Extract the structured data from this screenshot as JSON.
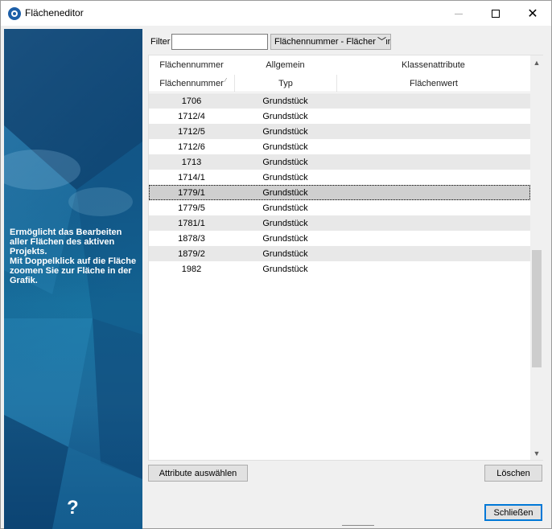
{
  "window": {
    "title": "Flächeneditor"
  },
  "sidebar": {
    "description": "Ermöglicht das Bearbeiten aller Flächen des aktiven Projekts.\nMit Doppelklick auf die Fläche zoomen Sie zur Fläche in der Grafik.",
    "help": "?"
  },
  "filter": {
    "label": "Filter",
    "value": "",
    "select_value": "Flächennummer - Flächennummer"
  },
  "grid": {
    "group_headers": [
      "Flächennummer",
      "Allgemein",
      "Klassenattribute"
    ],
    "columns": [
      "Flächennummer",
      "Typ",
      "Flächenwert"
    ],
    "sort_column": "Flächennummer",
    "sort_direction": "ascending",
    "rows": [
      {
        "nummer": "1706",
        "typ": "Grundstück",
        "wert": ""
      },
      {
        "nummer": "1712/4",
        "typ": "Grundstück",
        "wert": ""
      },
      {
        "nummer": "1712/5",
        "typ": "Grundstück",
        "wert": ""
      },
      {
        "nummer": "1712/6",
        "typ": "Grundstück",
        "wert": ""
      },
      {
        "nummer": "1713",
        "typ": "Grundstück",
        "wert": ""
      },
      {
        "nummer": "1714/1",
        "typ": "Grundstück",
        "wert": ""
      },
      {
        "nummer": "1779/1",
        "typ": "Grundstück",
        "wert": ""
      },
      {
        "nummer": "1779/5",
        "typ": "Grundstück",
        "wert": ""
      },
      {
        "nummer": "1781/1",
        "typ": "Grundstück",
        "wert": ""
      },
      {
        "nummer": "1878/3",
        "typ": "Grundstück",
        "wert": ""
      },
      {
        "nummer": "1879/2",
        "typ": "Grundstück",
        "wert": ""
      },
      {
        "nummer": "1982",
        "typ": "Grundstück",
        "wert": ""
      }
    ],
    "selected_row": "1779/1"
  },
  "buttons": {
    "attributes": "Attribute auswählen",
    "delete": "Löschen",
    "close": "Schließen"
  },
  "colors": {
    "selection": "#cfcfcf",
    "alt_row": "#e8e8e8",
    "sidebar_blue": "#1a79a6",
    "default_button_border": "#0078d7"
  }
}
